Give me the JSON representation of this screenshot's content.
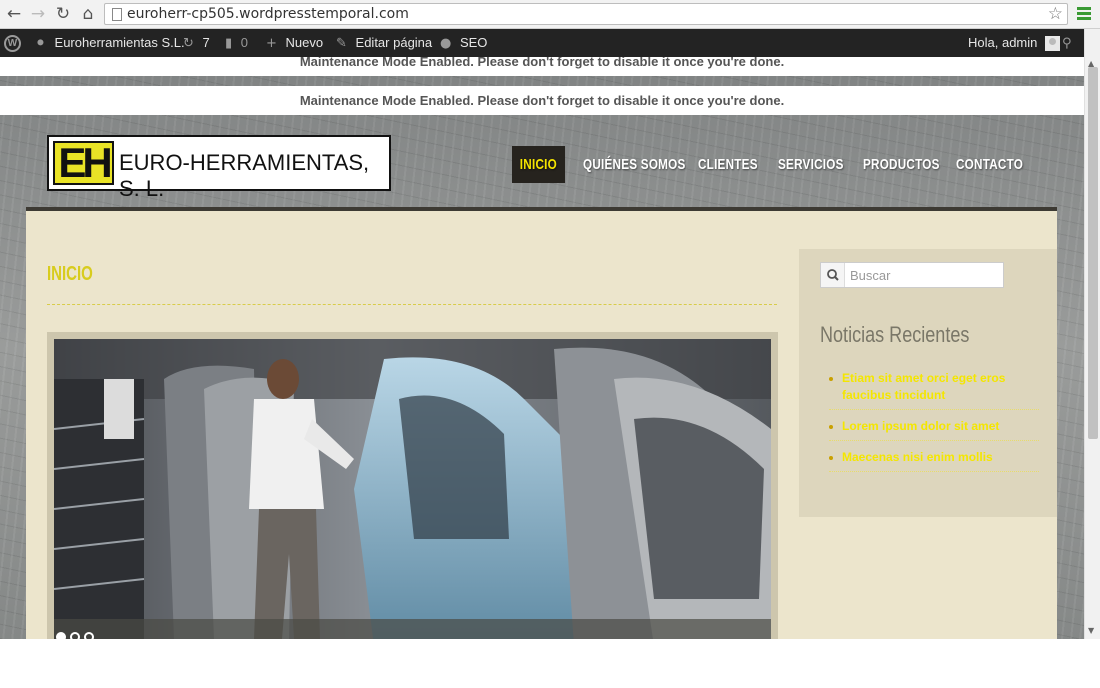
{
  "browser": {
    "url": "euroherr-cp505.wordpresstemporal.com",
    "nav_icons": [
      "back-icon",
      "forward-icon",
      "reload-icon",
      "home-icon",
      "page-icon",
      "star-icon",
      "menu-icon"
    ]
  },
  "adminbar": {
    "site_name": "Euroherramientas S.L.",
    "updates_count": "7",
    "comments_count": "0",
    "new_label": "Nuevo",
    "edit_label": "Editar página",
    "seo_label": "SEO",
    "greeting": "Hola, admin"
  },
  "notices": {
    "maintenance_1": "Maintenance Mode Enabled. Please don't forget to disable it once you're done.",
    "maintenance_2": "Maintenance Mode Enabled. Please don't forget to disable it once you're done."
  },
  "site": {
    "logo_mark": "EH",
    "logo_text": "EURO-HERRAMIENTAS, S. L.",
    "nav": [
      "INICIO",
      "QUIÉNES SOMOS",
      "CLIENTES",
      "SERVICIOS",
      "PRODUCTOS",
      "CONTACTO"
    ],
    "active_nav": "INICIO"
  },
  "main": {
    "page_title": "INICIO",
    "slider": {
      "slide_count": 3,
      "active_slide": 1
    }
  },
  "sidebar": {
    "search_placeholder": "Buscar",
    "recent_title": "Noticias Recientes",
    "recent_posts": [
      "Etiam sit amet orci eget eros faucibus tincidunt",
      "Lorem ipsum dolor sit amet",
      "Maecenas nisi enim mollis"
    ]
  },
  "colors": {
    "accent_yellow": "#f4e600",
    "title_yellow": "#d8cc1e",
    "adminbar_bg": "#232323",
    "content_bg": "#ece5cc",
    "sidebar_bg": "#ddd6bd"
  }
}
